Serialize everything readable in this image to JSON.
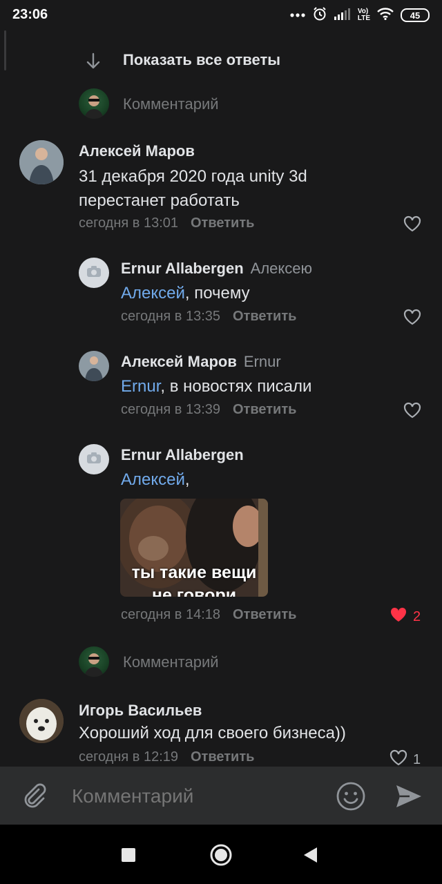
{
  "status_bar": {
    "time": "23:06",
    "lte_top": "Vo)",
    "lte_bottom": "LTE",
    "battery": "45"
  },
  "thread": {
    "show_all_label": "Показать все ответы",
    "comment_placeholder": "Комментарий"
  },
  "comments": [
    {
      "author": "Алексей Маров",
      "text": "31 декабря 2020 года unity 3d перестанет работать",
      "time": "сегодня в 13:01",
      "reply_label": "Ответить"
    },
    {
      "author": "Ernur Allabergen",
      "reply_to": "Алексею",
      "mention": "Алексей",
      "text": ", почему",
      "time": "сегодня в 13:35",
      "reply_label": "Ответить"
    },
    {
      "author": "Алексей Маров",
      "reply_to": "Ernur",
      "mention": "Ernur",
      "text": ", в новостях писали",
      "time": "сегодня в 13:39",
      "reply_label": "Ответить"
    },
    {
      "author": "Ernur Allabergen",
      "mention": "Алексей",
      "text": ",",
      "image_caption": "ты такие вещи",
      "image_caption_cut": "не говори",
      "time": "сегодня в 14:18",
      "reply_label": "Ответить",
      "likes": "2"
    }
  ],
  "thread2": {
    "comment_placeholder": "Комментарий"
  },
  "comment_last": {
    "author": "Игорь Васильев",
    "text": "Хороший ход для своего бизнеса))",
    "time": "сегодня в 12:19",
    "reply_label": "Ответить",
    "likes": "1"
  },
  "composer": {
    "placeholder": "Комментарий"
  },
  "colors": {
    "background": "#19191a",
    "mention": "#71aaeb",
    "like_active": "#ff3347",
    "composer": "#2c2d2e"
  },
  "icons": [
    "arrow-down-icon",
    "heart-outline-icon",
    "heart-filled-icon",
    "camera-icon",
    "attach-icon",
    "emoji-icon",
    "send-icon",
    "nav-square-icon",
    "nav-circle-icon",
    "nav-back-icon"
  ]
}
